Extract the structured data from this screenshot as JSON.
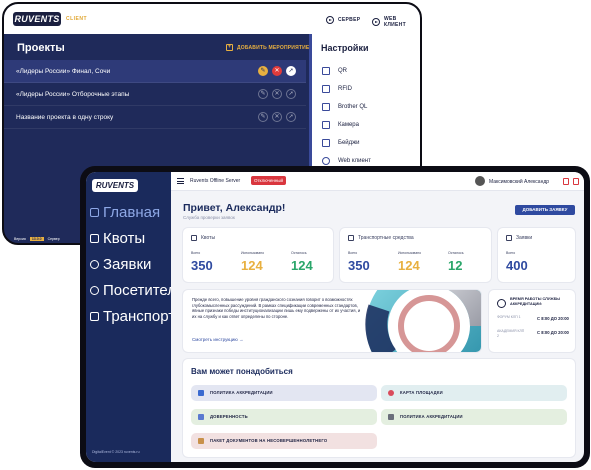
{
  "back_window": {
    "logo": "RUVENTS",
    "logo_sub": "CLIENT",
    "top_links": [
      "СЕРВЕР",
      "WEB КЛИЕНТ"
    ],
    "projects_title": "Проекты",
    "add_event": "ДОБАВИТЬ МЕРОПРИЯТИЕ",
    "projects": [
      "«Лидеры России» Финал, Сочи",
      "«Лидеры России» Отборочные этапы",
      "Название проекта в одну строку"
    ],
    "settings_title": "Настройки",
    "settings_items": [
      "QR",
      "RFID",
      "Brother QL",
      "Камера",
      "Бейджи",
      "Web клиент"
    ],
    "footer": [
      "Версия",
      "13.0.0",
      "Сервер"
    ]
  },
  "front": {
    "logo": "RUVENTS",
    "nav": [
      "Главная",
      "Квоты",
      "Заявки",
      "Посетители",
      "Транспорт"
    ],
    "footer": "DigitalEvent © 2023 ruvents.ru",
    "top_title": "Ruvents Offline Server",
    "status": "Отключенный",
    "user": "Максимовский Александр",
    "greeting": "Привет, Александр!",
    "greeting_sub": "Служба проверки заявок",
    "add_request": "ДОБАВИТЬ ЗАЯВКУ",
    "quotas": {
      "title": "Квоты",
      "labels": [
        "Всего",
        "Использовано",
        "Осталось"
      ],
      "values": [
        "350",
        "124",
        "124"
      ]
    },
    "transport": {
      "title": "Транспортные средства",
      "labels": [
        "Всего",
        "Использовано",
        "Осталось"
      ],
      "values": [
        "350",
        "124",
        "12"
      ]
    },
    "requests": {
      "title": "Заявки",
      "labels": [
        "Всего"
      ],
      "values": [
        "400"
      ]
    },
    "info_text": "Прежде всего, повышение уровня гражданского сознания говорит о возможностях глубокомысленных рассуждений. В рамках спецификации современных стандартов, явные признаки победы институционализации лишь ему подвержены от их участия, и их на службу и как ответ определены по стороне.",
    "info_link": "Смотреть инструкцию →",
    "hours": {
      "title": "ВРЕМЯ РАБОТЫ СЛУЖБЫ АККРЕДИТАЦИИ:",
      "rows": [
        {
          "label": "ФОРУМ КЛП 1",
          "value": "С 8:00 ДО 20:00"
        },
        {
          "label": "АКАДЕМИЯ КЛП 2",
          "value": "С 8:00 ДО 20:00"
        }
      ]
    },
    "useful_title": "Вам может понадобиться",
    "useful_items": [
      "ПОЛИТИКА АККРЕДИТАЦИИ",
      "КАРТА ПЛОЩАДКИ",
      "ДОВЕРЕННОСТЬ",
      "ПОЛИТИКА АККРЕДИТАЦИИ",
      "ПАКЕТ ДОКУМЕНТОВ НА НЕСОВЕРШЕННОЛЕТНЕГО"
    ]
  },
  "colors": {
    "navy": "#1f2a5a",
    "accent_yellow": "#e8b040",
    "blue": "#2f4aa0",
    "green": "#2aa66a",
    "red": "#d9363e"
  }
}
